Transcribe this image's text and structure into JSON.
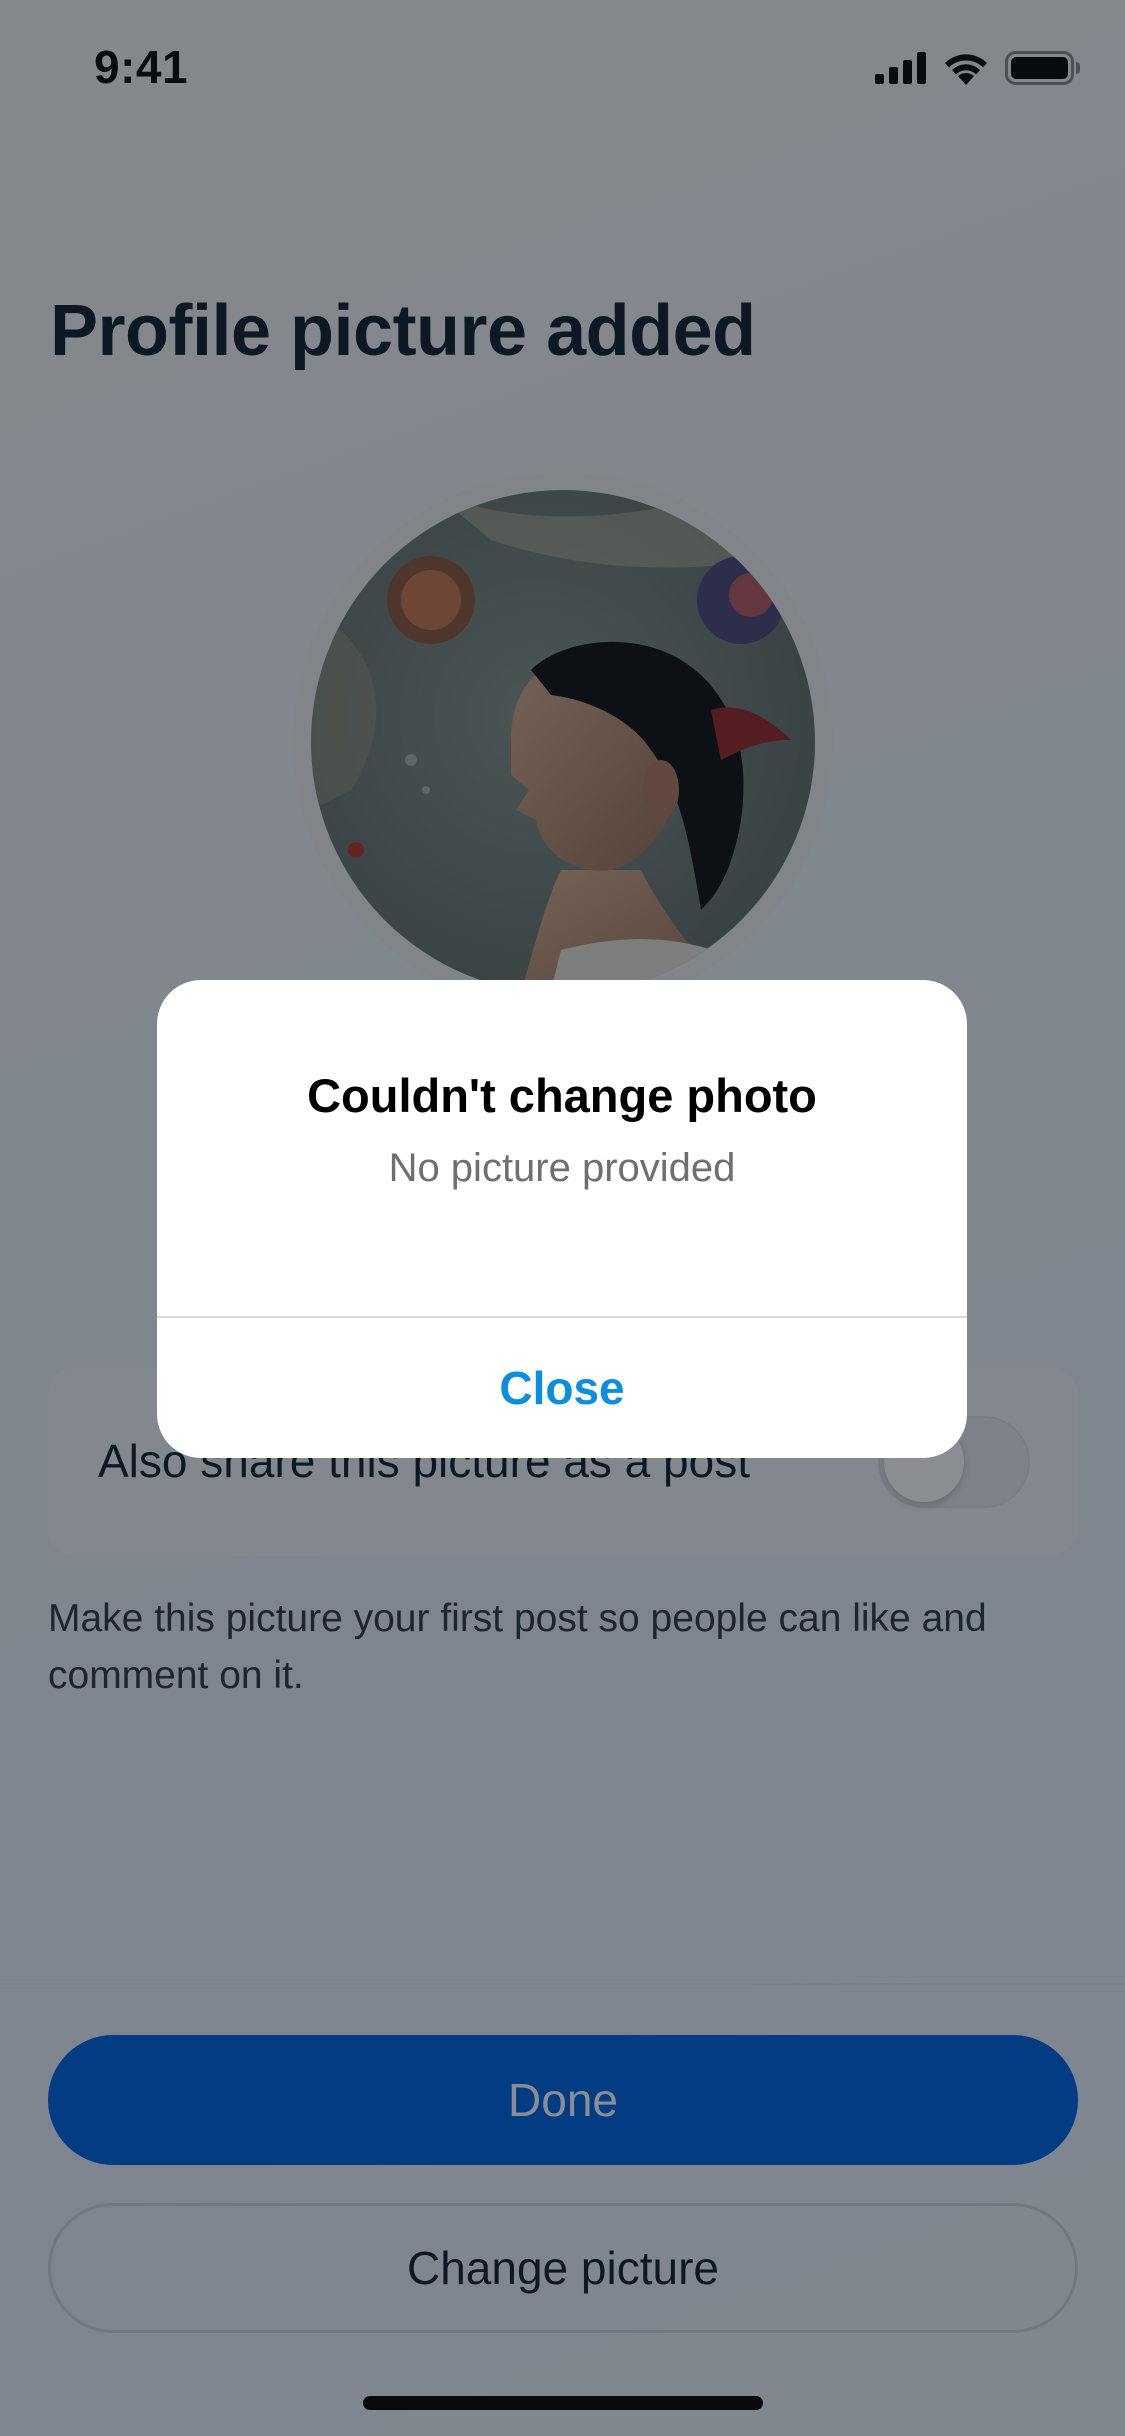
{
  "status_bar": {
    "time": "9:41",
    "icons": [
      "signal-icon",
      "wifi-icon",
      "battery-icon"
    ]
  },
  "page": {
    "title": "Profile picture added"
  },
  "share": {
    "label": "Also share this picture as a post",
    "toggle_on": false,
    "description": "Make this picture your first post so people can like and comment on it."
  },
  "buttons": {
    "done": "Done",
    "change_picture": "Change picture"
  },
  "alert": {
    "title": "Couldn't change photo",
    "message": "No picture provided",
    "close": "Close"
  },
  "colors": {
    "primary_button": "#0064e0",
    "alert_action": "#0a8ee0",
    "title_text": "#12232e"
  }
}
